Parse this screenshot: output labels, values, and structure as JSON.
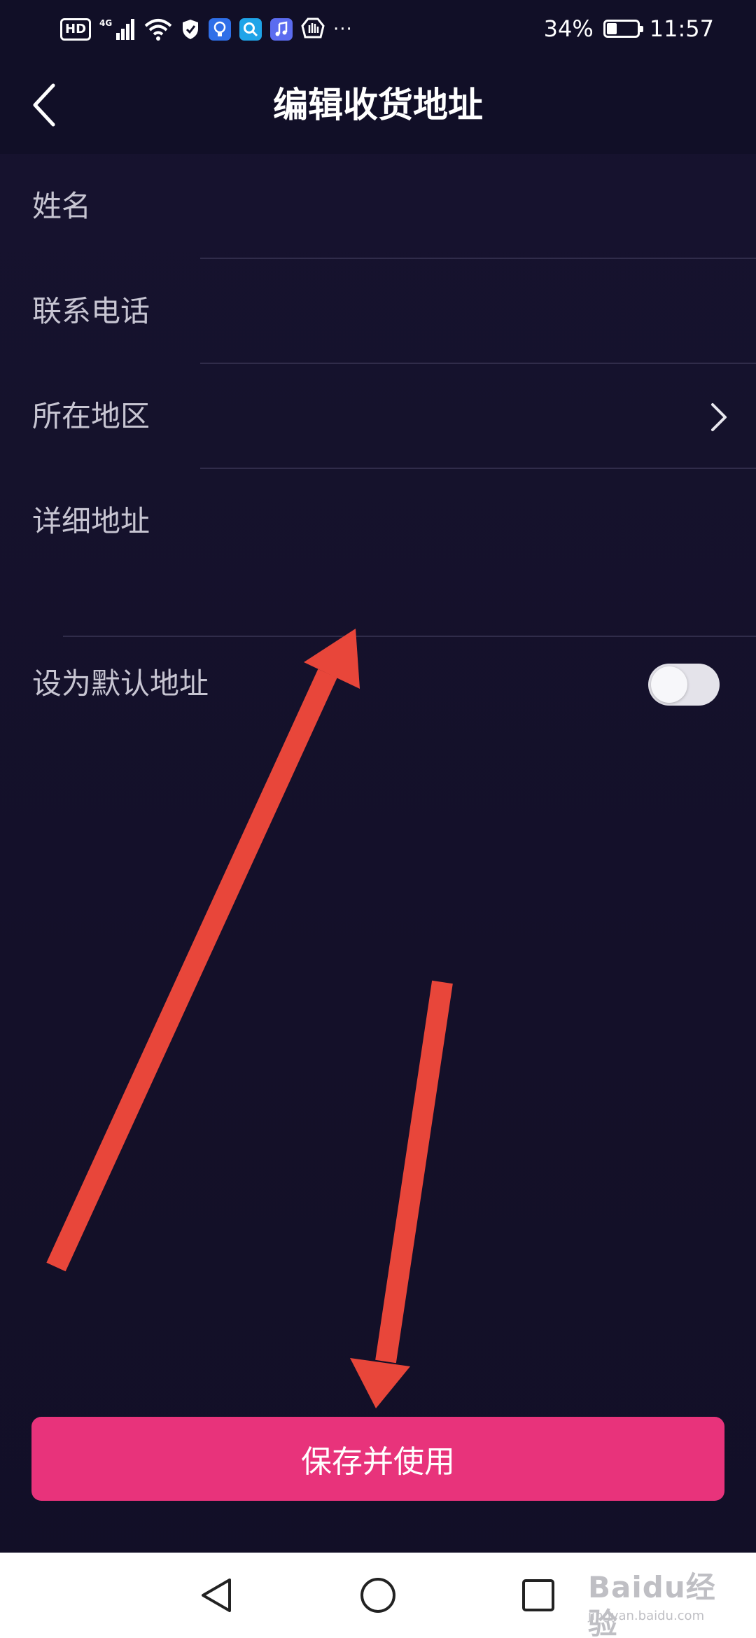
{
  "status_bar": {
    "hd": "HD",
    "network": "4G",
    "dots": "···",
    "battery_percent": "34%",
    "battery_level": 0.34,
    "time": "11:57",
    "icons": [
      "hd-icon",
      "signal-icon",
      "wifi-icon",
      "shield-icon",
      "bulb-app-icon",
      "search-app-icon",
      "music-app-icon",
      "hand-app-icon",
      "more-icon"
    ]
  },
  "header": {
    "title": "编辑收货地址",
    "back_icon": "chevron-left-icon"
  },
  "form": {
    "name_label": "姓名",
    "phone_label": "联系电话",
    "region_label": "所在地区",
    "address_label": "详细地址",
    "name_value": "",
    "phone_value": "",
    "region_value": "",
    "address_value": ""
  },
  "default_address": {
    "label": "设为默认地址",
    "enabled": false
  },
  "actions": {
    "save_label": "保存并使用"
  },
  "colors": {
    "background": "#161330",
    "header": "#110f27",
    "accent": "#e8337b",
    "annotation_arrow": "#e8463a",
    "divider": "#302c4a"
  },
  "nav_bar": {
    "icons": [
      "back-triangle-icon",
      "home-circle-icon",
      "recents-square-icon"
    ]
  },
  "watermark": {
    "main": "Baidu经验",
    "sub": "jingyan.baidu.com"
  }
}
